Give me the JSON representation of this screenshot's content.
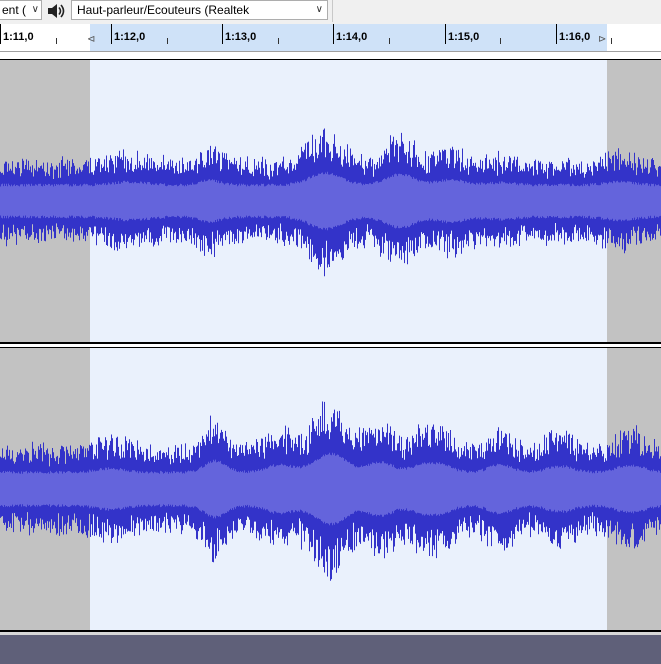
{
  "toolbar": {
    "recording_device_partial": "ent (",
    "playback_device": "Haut-parleur/Ecouteurs (Realtek",
    "dropdown_arrow": "∨",
    "speaker_icon": "speaker-icon"
  },
  "ruler": {
    "labels": [
      "1:11,0",
      "1:12,0",
      "1:13,0",
      "1:14,0",
      "1:15,0",
      "1:16,0"
    ]
  },
  "colors": {
    "waveform_peak": "#3333c9",
    "waveform_rms": "#6464dc",
    "selection_bg": "#eaf1fc",
    "track_bg": "#c2c2c2",
    "ruler_selection": "#cfe2f8",
    "empty_area": "#5f6079"
  }
}
